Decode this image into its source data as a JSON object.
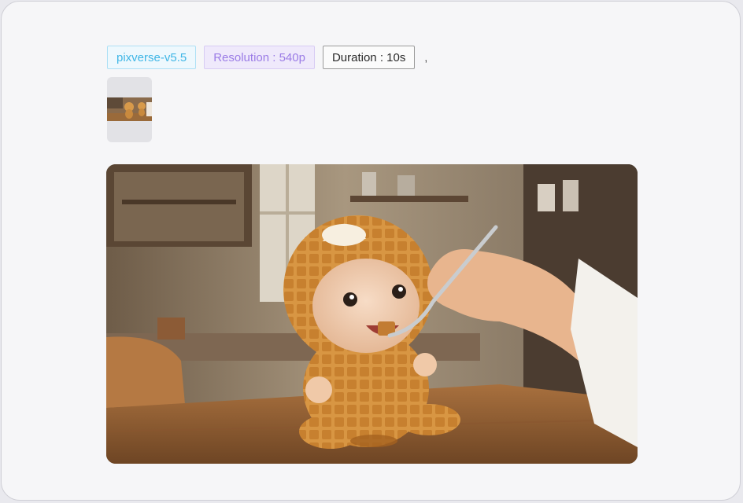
{
  "tags": {
    "model": "pixverse-v5.5",
    "resolution": "Resolution : 540p",
    "duration": "Duration : 10s",
    "separator": ","
  },
  "colors": {
    "model_text": "#3fb6e6",
    "resolution_text": "#9b7ce6",
    "duration_text": "#2a2a2a"
  },
  "media": {
    "thumbnail_icon": "waffle-baby-thumbnail",
    "preview_icon": "waffle-baby-video-preview"
  }
}
